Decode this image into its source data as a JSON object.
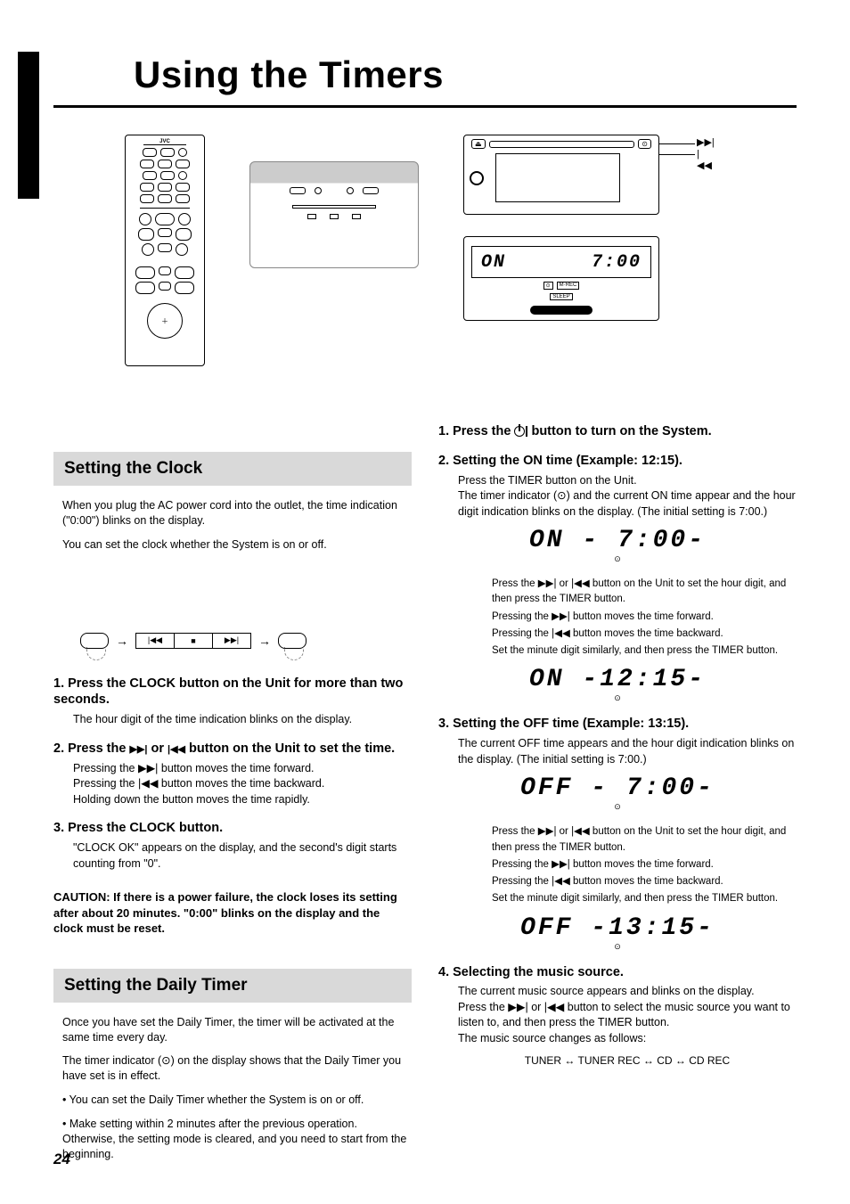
{
  "page": {
    "title": "Using the Timers",
    "number": "24"
  },
  "hero": {
    "remote_brand": "JVC",
    "lcd_on": "ON",
    "lcd_time": "7:00",
    "lead_top": "▶▶|",
    "lead_bot": "|◀◀",
    "tag1": "M·REC",
    "tag2": "SLEEP"
  },
  "left": {
    "section1_title": "Setting the Clock",
    "intro1": "When you plug the AC power cord into the outlet, the time indication (\"0:00\") blinks on the display.",
    "intro2": "You can set the clock whether the System is on or off.",
    "diagram": {
      "prev": "|◀◀",
      "stop": "■",
      "next": "▶▶|"
    },
    "step1": "1. Press the CLOCK button on the Unit for more than two seconds.",
    "step1_sub": "The hour digit of the time indication blinks on the display.",
    "step2_a": "2. Press the ",
    "step2_b": " or ",
    "step2_c": " button on the Unit to set the time.",
    "step2_sub1": "Pressing the ▶▶| button moves the time forward.",
    "step2_sub2": "Pressing the |◀◀ button moves the time backward.",
    "step2_sub3": "Holding down the button moves the time rapidly.",
    "step3": "3. Press the CLOCK button.",
    "step3_sub": "\"CLOCK OK\" appears on the display, and the second's digit starts counting from \"0\".",
    "caution": "CAUTION: If there is a power failure, the clock loses its setting after about 20 minutes. \"0:00\" blinks on the display and the clock must be reset.",
    "section2_title": "Setting the Daily Timer",
    "daily_intro1": "Once you have set the Daily Timer, the timer will be activated at the same time every day.",
    "daily_intro2": "The timer indicator (⊙) on the display shows that the Daily Timer you have set is in effect.",
    "daily_note1": "• You can set the Daily Timer whether the System is on or off.",
    "daily_note2": "• Make setting within 2 minutes after the previous operation. Otherwise, the setting mode is cleared, and you need to start from the beginning."
  },
  "right": {
    "step1_a": "1. Press the ",
    "step1_b": " button to turn on the System.",
    "step2": "2. Setting the ON time (Example: 12:15).",
    "step2_sub1": "Press the TIMER button on the Unit.",
    "step2_sub2": "The timer indicator (⊙) and the current ON time appear and the hour digit indication blinks on the display. (The initial setting is 7:00.)",
    "seg_on1": "ON    - 7:00-",
    "step2_sub3": "Press the ▶▶| or |◀◀ button on the Unit to set the hour digit, and then press the TIMER button.",
    "step2_sub4": "Pressing the ▶▶| button moves the time forward.",
    "step2_sub5": "Pressing the |◀◀ button moves the time backward.",
    "step2_sub6": "Set the minute digit similarly, and then press the TIMER button.",
    "seg_on2": "ON   -12:15-",
    "step3": "3. Setting the OFF time (Example: 13:15).",
    "step3_sub1": "The current OFF time appears and the hour digit indication blinks on the display. (The initial setting is 7:00.)",
    "seg_off1": "OFF   - 7:00-",
    "step3_sub2": "Press the ▶▶| or |◀◀ button on the Unit to set the hour digit, and then press the TIMER button.",
    "step3_sub3": "Pressing the ▶▶| button moves the time forward.",
    "step3_sub4": "Pressing the |◀◀ button moves the time backward.",
    "step3_sub5": "Set the minute digit similarly, and then press the TIMER button.",
    "seg_off2": "OFF  -13:15-",
    "step4": "4. Selecting the music source.",
    "step4_sub1": "The current music source appears and blinks on the display.",
    "step4_sub2": "Press the ▶▶| or |◀◀ button to select the music source you want to listen to, and then press the TIMER button.",
    "step4_sub3": "The music source changes as follows:",
    "step4_cycle": "TUNER ↔ TUNER REC ↔ CD ↔ CD REC"
  }
}
